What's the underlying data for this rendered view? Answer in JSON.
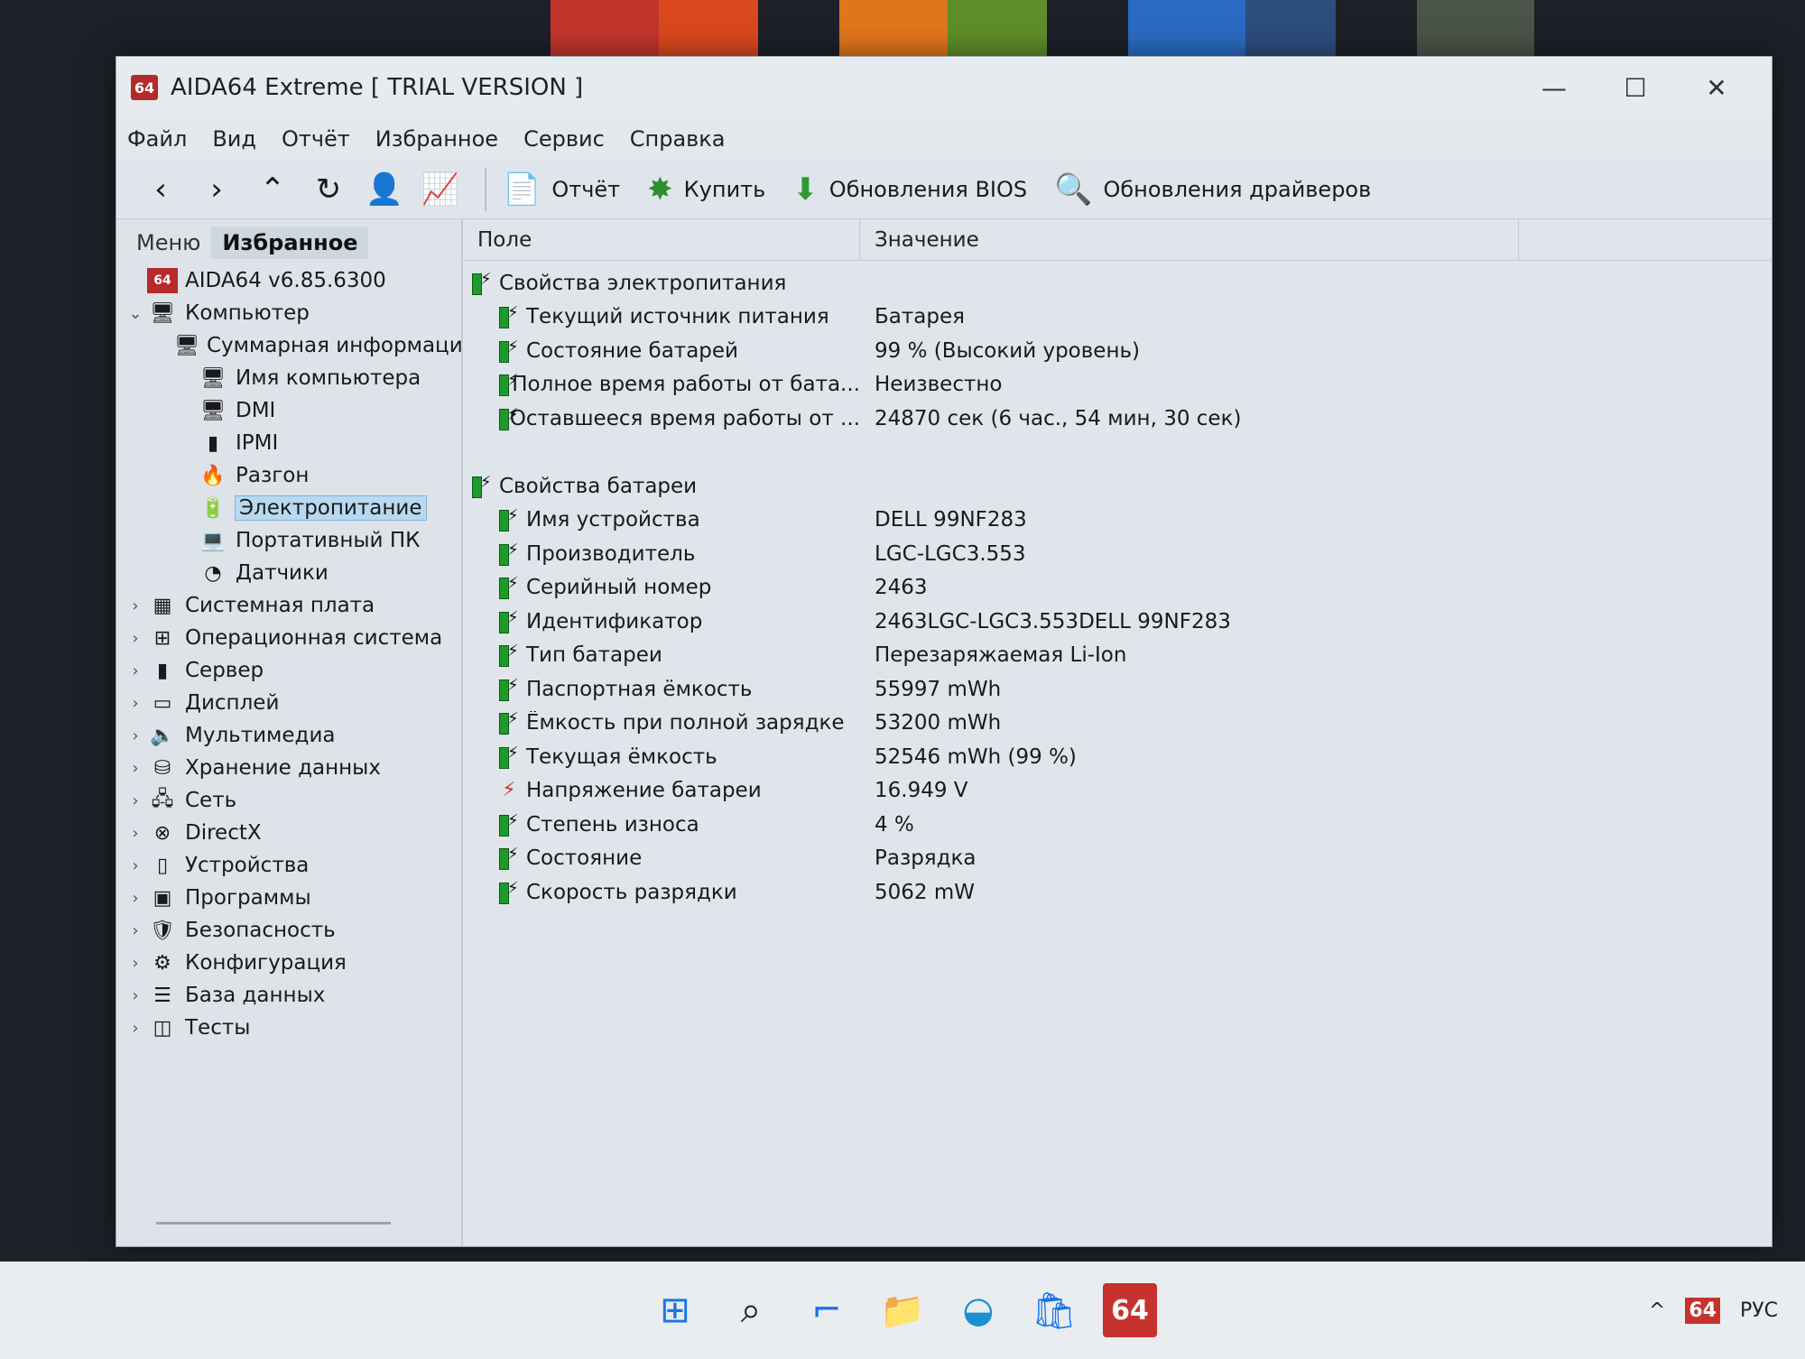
{
  "window": {
    "logo": "64",
    "title": "AIDA64 Extreme  [ TRIAL VERSION ]",
    "minimize": "—",
    "maximize": "☐",
    "close": "✕"
  },
  "menu": [
    "Файл",
    "Вид",
    "Отчёт",
    "Избранное",
    "Сервис",
    "Справка"
  ],
  "toolbar": {
    "icons": [
      "back-icon",
      "forward-icon",
      "up-icon",
      "refresh-icon",
      "user-icon",
      "chart-icon"
    ],
    "buttons": [
      {
        "label": "Отчёт",
        "icon": "report-icon"
      },
      {
        "label": "Купить",
        "icon": "buy-icon"
      },
      {
        "label": "Обновления BIOS",
        "icon": "download-icon"
      },
      {
        "label": "Обновления драйверов",
        "icon": "search-icon"
      }
    ]
  },
  "left_tabs": [
    "Меню",
    "Избранное"
  ],
  "tree": [
    {
      "label": "AIDA64 v6.85.6300",
      "icon": "aida-icon",
      "level": 0,
      "exp": ""
    },
    {
      "label": "Компьютер",
      "icon": "computer-icon",
      "level": 0,
      "exp": "⌄"
    },
    {
      "label": "Суммарная информация",
      "icon": "monitor-icon",
      "level": 1,
      "exp": ""
    },
    {
      "label": "Имя компьютера",
      "icon": "monitor-icon",
      "level": 1,
      "exp": ""
    },
    {
      "label": "DMI",
      "icon": "monitor-icon",
      "level": 1,
      "exp": ""
    },
    {
      "label": "IPMI",
      "icon": "server-icon",
      "level": 1,
      "exp": ""
    },
    {
      "label": "Разгон",
      "icon": "flame-icon",
      "level": 1,
      "exp": ""
    },
    {
      "label": "Электропитание",
      "icon": "battery-icon",
      "level": 1,
      "exp": "",
      "selected": true
    },
    {
      "label": "Портативный ПК",
      "icon": "laptop-icon",
      "level": 1,
      "exp": ""
    },
    {
      "label": "Датчики",
      "icon": "gauge-icon",
      "level": 1,
      "exp": ""
    },
    {
      "label": "Системная плата",
      "icon": "board-icon",
      "level": 0,
      "exp": "›"
    },
    {
      "label": "Операционная система",
      "icon": "windows-icon",
      "level": 0,
      "exp": "›"
    },
    {
      "label": "Сервер",
      "icon": "server-icon",
      "level": 0,
      "exp": "›"
    },
    {
      "label": "Дисплей",
      "icon": "display-icon",
      "level": 0,
      "exp": "›"
    },
    {
      "label": "Мультимедиа",
      "icon": "speaker-icon",
      "level": 0,
      "exp": "›"
    },
    {
      "label": "Хранение данных",
      "icon": "storage-icon",
      "level": 0,
      "exp": "›"
    },
    {
      "label": "Сеть",
      "icon": "network-icon",
      "level": 0,
      "exp": "›"
    },
    {
      "label": "DirectX",
      "icon": "xbox-icon",
      "level": 0,
      "exp": "›"
    },
    {
      "label": "Устройства",
      "icon": "device-icon",
      "level": 0,
      "exp": "›"
    },
    {
      "label": "Программы",
      "icon": "programs-icon",
      "level": 0,
      "exp": "›"
    },
    {
      "label": "Безопасность",
      "icon": "shield-icon",
      "level": 0,
      "exp": "›"
    },
    {
      "label": "Конфигурация",
      "icon": "config-icon",
      "level": 0,
      "exp": "›"
    },
    {
      "label": "База данных",
      "icon": "database-icon",
      "level": 0,
      "exp": "›"
    },
    {
      "label": "Тесты",
      "icon": "tests-icon",
      "level": 0,
      "exp": "›"
    }
  ],
  "columns": {
    "field": "Поле",
    "value": "Значение"
  },
  "rows": [
    {
      "type": "group",
      "field": "Свойства электропитания",
      "value": ""
    },
    {
      "type": "item",
      "field": "Текущий источник питания",
      "value": "Батарея"
    },
    {
      "type": "item",
      "field": "Состояние батарей",
      "value": "99 % (Высокий уровень)"
    },
    {
      "type": "item",
      "field": "Полное время работы от бата...",
      "value": "Неизвестно"
    },
    {
      "type": "item",
      "field": "Оставшееся время работы от ...",
      "value": "24870 сек (6 час., 54 мин, 30 сек)"
    },
    {
      "type": "spacer"
    },
    {
      "type": "group",
      "field": "Свойства батареи",
      "value": ""
    },
    {
      "type": "item",
      "field": "Имя устройства",
      "value": "DELL 99NF283"
    },
    {
      "type": "item",
      "field": "Производитель",
      "value": "LGC-LGC3.553"
    },
    {
      "type": "item",
      "field": "Серийный номер",
      "value": "2463"
    },
    {
      "type": "item",
      "field": "Идентификатор",
      "value": "2463LGC-LGC3.553DELL 99NF283"
    },
    {
      "type": "item",
      "field": "Тип батареи",
      "value": "Перезаряжаемая Li-Ion"
    },
    {
      "type": "item",
      "field": "Паспортная ёмкость",
      "value": "55997 mWh"
    },
    {
      "type": "item",
      "field": "Ёмкость при полной зарядке",
      "value": "53200 mWh"
    },
    {
      "type": "item",
      "field": "Текущая ёмкость",
      "value": "52546 mWh  (99 %)"
    },
    {
      "type": "item",
      "field": "Напряжение батареи",
      "value": "16.949 V",
      "icon": "voltage"
    },
    {
      "type": "item",
      "field": "Степень износа",
      "value": "4 %"
    },
    {
      "type": "item",
      "field": "Состояние",
      "value": "Разрядка"
    },
    {
      "type": "item",
      "field": "Скорость разрядки",
      "value": "5062 mW"
    }
  ],
  "taskbar": {
    "apps": [
      "windows-start-icon",
      "search-icon",
      "widgets-icon",
      "folder-icon",
      "edge-icon",
      "store-icon",
      "aida64-icon"
    ],
    "aida_label": "64",
    "tray_lang": "РУС",
    "tray_caret": "^",
    "tray_app": "64"
  }
}
